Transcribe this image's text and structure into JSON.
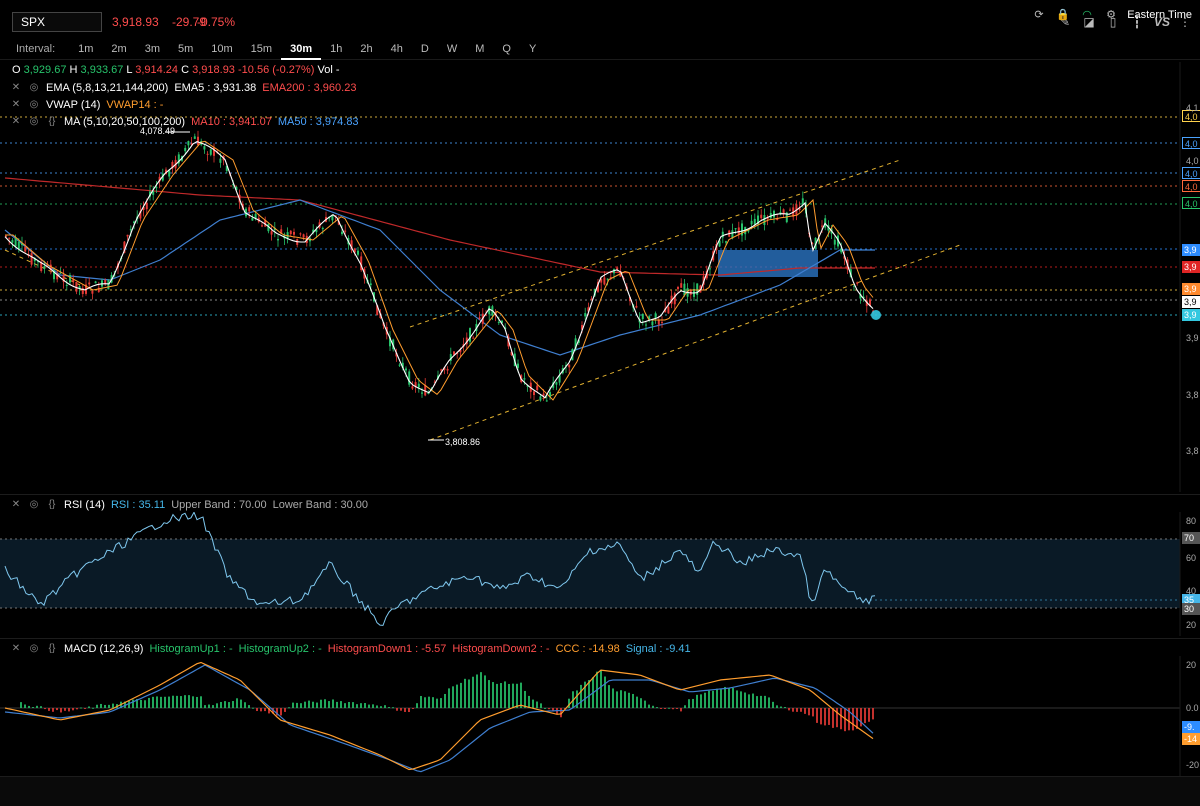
{
  "header": {
    "symbol": "SPX",
    "last": "3,918.93",
    "change": "-29.79",
    "change_pct": "-0.75%",
    "icons": [
      "pencil-icon",
      "chart-style-icon",
      "phone-icon",
      "candles-icon",
      "vs-compare-icon",
      "more-icon"
    ],
    "vs_label": "VS"
  },
  "intervals": {
    "label": "Interval:",
    "items": [
      "1m",
      "2m",
      "3m",
      "5m",
      "10m",
      "15m",
      "30m",
      "1h",
      "2h",
      "4h",
      "D",
      "W",
      "M",
      "Q",
      "Y"
    ],
    "active": "30m"
  },
  "ohlc": {
    "o_label": "O",
    "o": "3,929.67",
    "h_label": "H",
    "h": "3,933.67",
    "l_label": "L",
    "l": "3,914.24",
    "c_label": "C",
    "c": "3,918.93",
    "chg": "-10.56 (-0.27%)",
    "vol_label": "Vol",
    "vol": "-"
  },
  "studies": {
    "ema": {
      "name": "EMA (5,8,13,21,144,200)",
      "v1": "EMA5 : 3,931.38",
      "v2": "EMA200 : 3,960.23"
    },
    "vwap": {
      "name": "VWAP (14)",
      "v1": "VWAP14 : -"
    },
    "ma": {
      "name": "MA (5,10,20,50,100,200)",
      "v1": "MA10 : 3,941.07",
      "v2": "MA50 : 3,974.83"
    },
    "rsi": {
      "name": "RSI (14)",
      "v1": "RSI : 35.11",
      "v2": "Upper Band : 70.00",
      "v3": "Lower Band : 30.00"
    },
    "macd": {
      "name": "MACD (12,26,9)",
      "v1": "HistogramUp1 : -",
      "v2": "HistogramUp2 : -",
      "v3": "HistogramDown1 : -5.57",
      "v4": "HistogramDown2 : -",
      "v5": "CCC : -14.98",
      "v6": "Signal : -9.41"
    }
  },
  "price_panel": {
    "high_callout": "4,078.49",
    "low_callout": "3,808.86",
    "axis_tags": [
      {
        "text": "4,0",
        "color": "#ffd34d"
      },
      {
        "text": "4,0",
        "color": "#4aa3ff"
      },
      {
        "text": "4,0",
        "color": "#4aa3ff"
      },
      {
        "text": "4,0",
        "color": "#ff6a3d"
      },
      {
        "text": "4,0",
        "color": "#27c46b"
      },
      {
        "text": "3,9",
        "color": "#2d8cff"
      },
      {
        "text": "3,9",
        "color": "#e02525"
      },
      {
        "text": "3,9",
        "color": "#ff8a2e"
      },
      {
        "text": "3,9",
        "color": "#ffffff"
      },
      {
        "text": "3,9",
        "color": "#34c8e0"
      }
    ],
    "axis_labels": [
      "4,1",
      "4,0",
      "3,9",
      "3,8",
      "3,8"
    ]
  },
  "rsi_panel": {
    "axis_labels": [
      "80",
      "60",
      "40",
      "20"
    ],
    "tags": [
      {
        "text": "70",
        "color": "#555"
      },
      {
        "text": "35",
        "color": "#45b6e8"
      },
      {
        "text": "30",
        "color": "#555"
      }
    ]
  },
  "macd_panel": {
    "axis_labels": [
      "20",
      "0.0",
      "-20"
    ],
    "tags": [
      {
        "text": "-9.",
        "color": "#2d8cff"
      },
      {
        "text": "-14",
        "color": "#ff9d2e"
      }
    ]
  },
  "footer": {
    "timezone": "Eastern Time",
    "icons": [
      "refresh-icon",
      "lock-icon",
      "wifi-icon",
      "settings-icon"
    ]
  }
}
